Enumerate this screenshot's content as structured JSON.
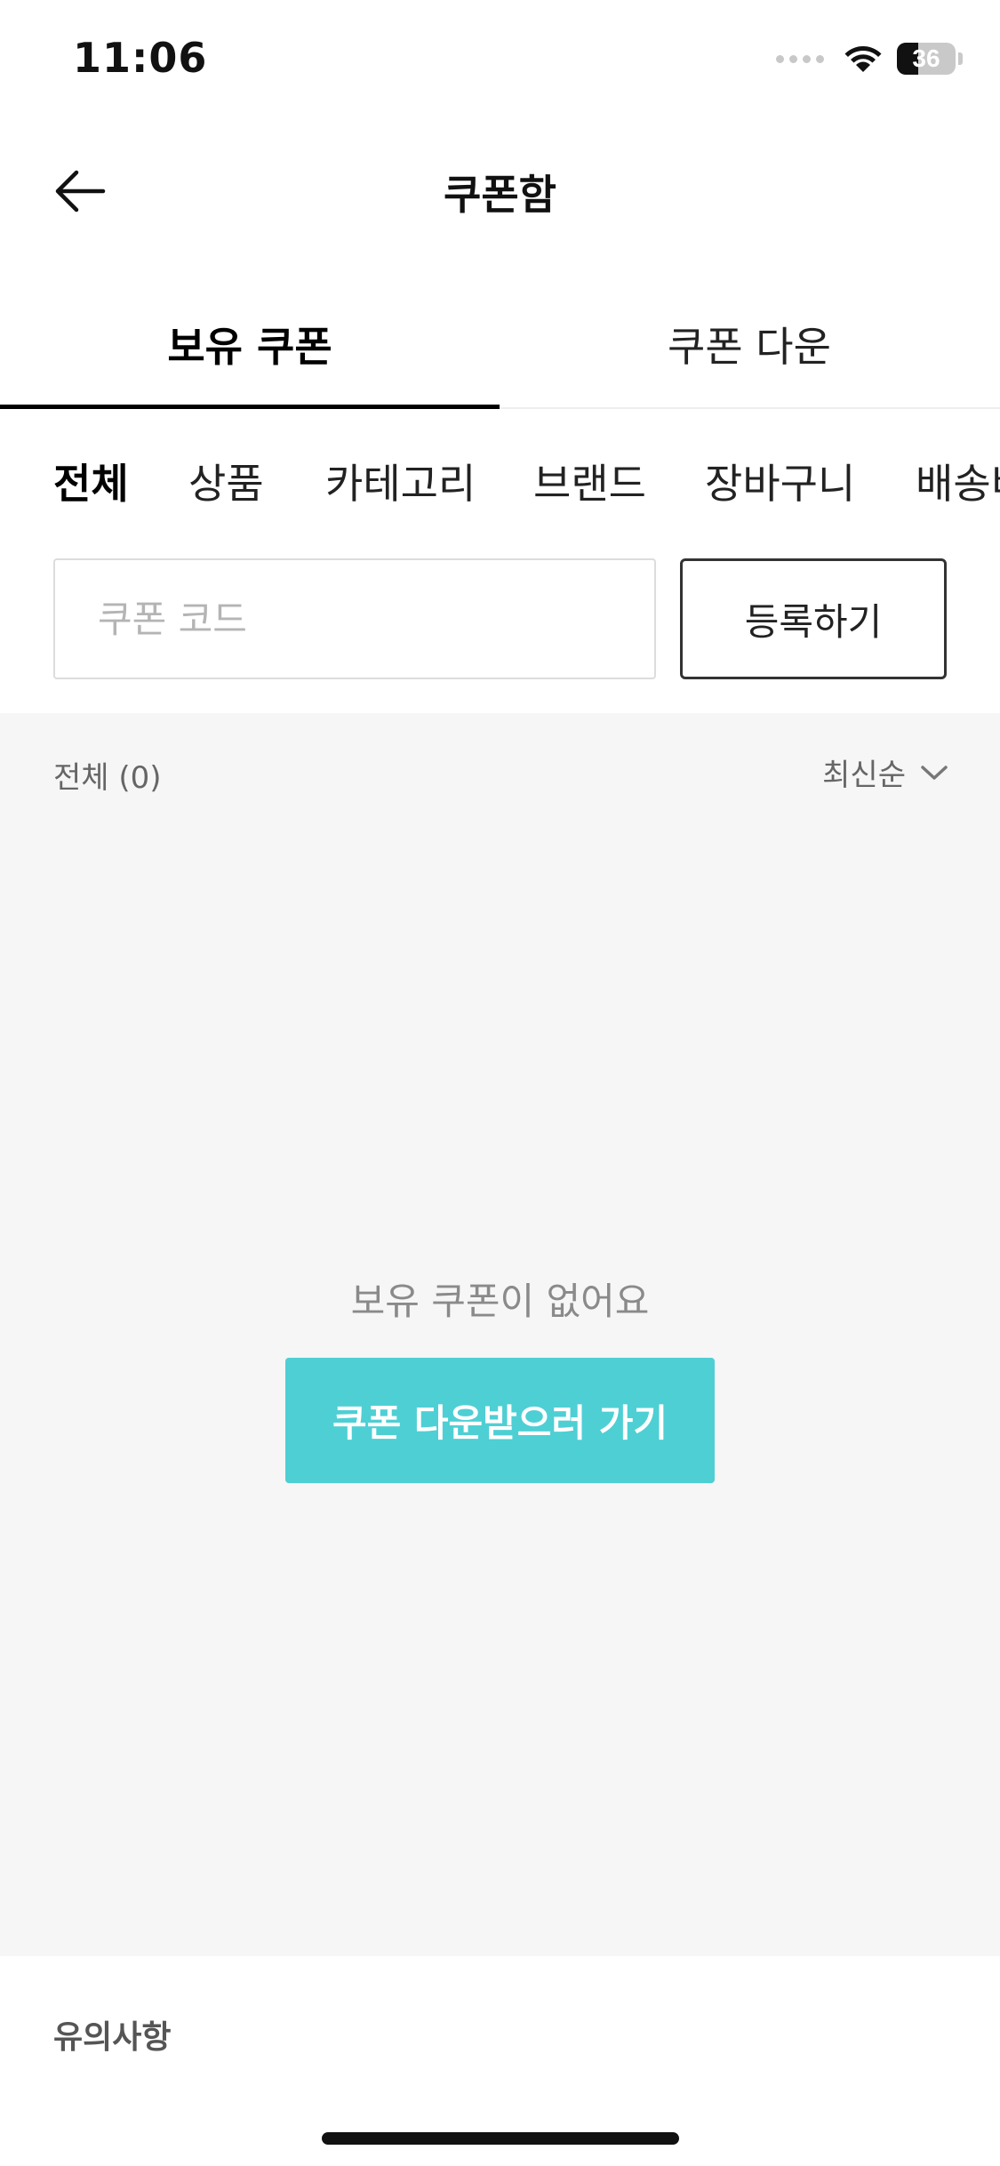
{
  "status_bar": {
    "time": "11:06",
    "battery_percent": "36",
    "battery_level": 0.36
  },
  "nav": {
    "title": "쿠폰함",
    "back_icon": "arrow-left-icon"
  },
  "tabs": [
    {
      "label": "보유 쿠폰",
      "active": true
    },
    {
      "label": "쿠폰 다운",
      "active": false
    }
  ],
  "filters": [
    {
      "label": "전체",
      "active": true
    },
    {
      "label": "상품",
      "active": false
    },
    {
      "label": "카테고리",
      "active": false
    },
    {
      "label": "브랜드",
      "active": false
    },
    {
      "label": "장바구니",
      "active": false
    },
    {
      "label": "배송비",
      "active": false
    }
  ],
  "coupon_code": {
    "placeholder": "쿠폰 코드",
    "value": "",
    "register_label": "등록하기"
  },
  "list": {
    "count_label": "전체 (0)",
    "sort_label": "최신순",
    "sort_icon": "chevron-down-icon",
    "empty_message": "보유 쿠폰이 없어요",
    "cta_label": "쿠폰 다운받으러 가기"
  },
  "notice": {
    "label": "유의사항"
  },
  "colors": {
    "accent": "#4ecfd4",
    "list_background": "#f6f6f6",
    "text_primary": "#111111",
    "text_secondary": "#666666"
  }
}
